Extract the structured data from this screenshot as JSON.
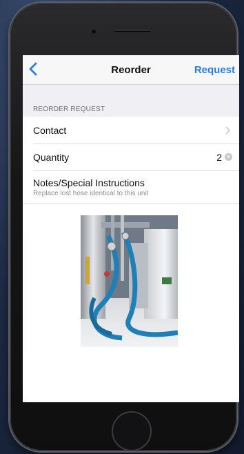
{
  "navbar": {
    "title": "Reorder",
    "request_label": "Request"
  },
  "section": {
    "header": "REORDER REQUEST"
  },
  "rows": {
    "contact_label": "Contact",
    "quantity_label": "Quantity",
    "quantity_value": "2",
    "notes_label": "Notes/Special Instructions",
    "notes_value": "Replace lost hose identical to this unit"
  },
  "colors": {
    "accent": "#2a7fd8",
    "hose": "#1f7fb6"
  },
  "icons": [
    "back-chevron-icon",
    "chevron-right-icon",
    "clear-icon"
  ]
}
